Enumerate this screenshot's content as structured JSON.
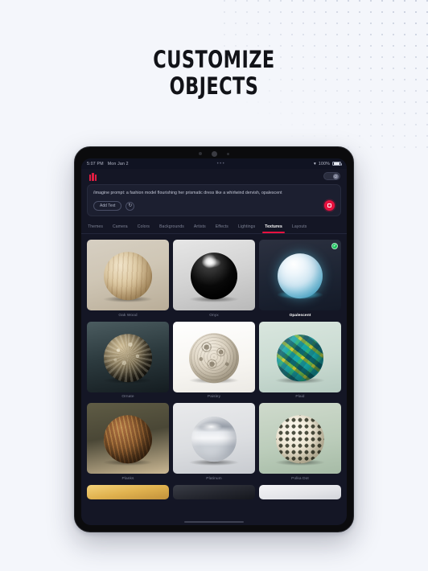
{
  "promo": {
    "heading_line1": "CUSTOMIZE",
    "heading_line2": "OBJECTS"
  },
  "device": {
    "status_bar": {
      "time": "5:07 PM",
      "date": "Mon Jan 2",
      "center_dots": "•••",
      "wifi_icon": "wifi-icon",
      "battery_percent": "100%"
    }
  },
  "app": {
    "logo_name": "app-logo",
    "preview_toggle": {
      "label": "preview-toggle",
      "state": "on",
      "knob_icon": "power-icon"
    },
    "prompt": {
      "text": "/imagine prompt: a fashion model flourishing her prismatic dress like a whirlwind dervish, opalescent",
      "add_text_label": "Add Text",
      "refresh_icon": "refresh-icon",
      "record_button": "record-button",
      "accent_color": "#e8113f"
    },
    "tabs": {
      "items": [
        {
          "label": "Themes",
          "active": false
        },
        {
          "label": "Camera",
          "active": false
        },
        {
          "label": "Colors",
          "active": false
        },
        {
          "label": "Backgrounds",
          "active": false
        },
        {
          "label": "Artists",
          "active": false
        },
        {
          "label": "Effects",
          "active": false
        },
        {
          "label": "Lightings",
          "active": false
        },
        {
          "label": "Textures",
          "active": true
        },
        {
          "label": "Layouts",
          "active": false
        }
      ],
      "active_label": "Textures",
      "indicator_color": "#e8113f"
    },
    "textures": {
      "selected": "Opalescent",
      "check_icon": "check-icon",
      "items": [
        {
          "label": "Oak Wood",
          "selected": false,
          "scene": "oak"
        },
        {
          "label": "Onyx",
          "selected": false,
          "scene": "onyx"
        },
        {
          "label": "Opalescent",
          "selected": true,
          "scene": "opal"
        },
        {
          "label": "Ornate",
          "selected": false,
          "scene": "ornate"
        },
        {
          "label": "Paisley",
          "selected": false,
          "scene": "paisley"
        },
        {
          "label": "Plaid",
          "selected": false,
          "scene": "plaid"
        },
        {
          "label": "Planks",
          "selected": false,
          "scene": "planks"
        },
        {
          "label": "Platinum",
          "selected": false,
          "scene": "plat"
        },
        {
          "label": "Polka Dot",
          "selected": false,
          "scene": "polka"
        }
      ]
    }
  }
}
